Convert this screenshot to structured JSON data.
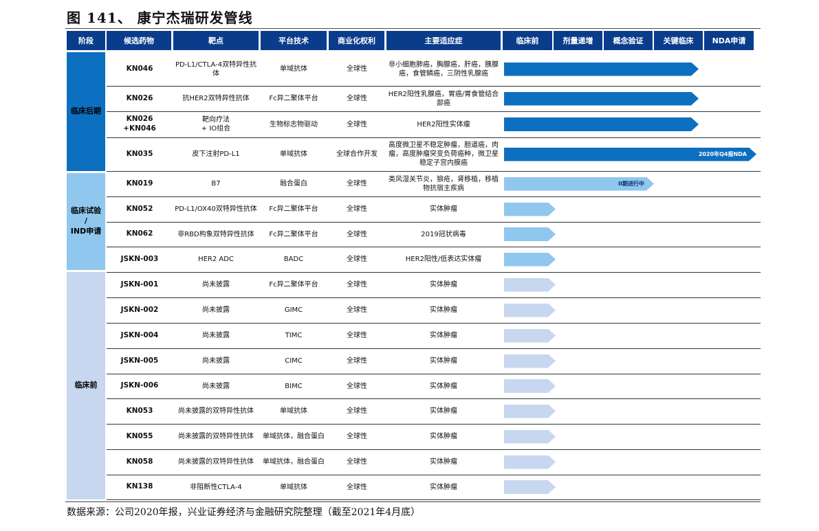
{
  "figure_title": "图 141、 康宁杰瑞研发管线",
  "source_note": "数据来源：公司2020年报，兴业证券经济与金融研究院整理（截至2021年4月底）",
  "colors": {
    "header_bg": "#0a3c8c",
    "stage_late": "#0d6fbf",
    "stage_ind": "#8fc7ee",
    "stage_pre": "#c6d7ef",
    "arrow_late": "#0d6fbf",
    "arrow_ind": "#8fc7ee",
    "arrow_pre": "#c6d7ef"
  },
  "headers": {
    "stage": "阶段",
    "drug": "候选药物",
    "target": "靶点",
    "platform": "平台技术",
    "commercial": "商业化权利",
    "indication": "主要适应症",
    "phases": [
      "临床前",
      "剂量递增",
      "概念验证",
      "关键临床",
      "NDA申请"
    ]
  },
  "stages": [
    {
      "label": "临床后期"
    },
    {
      "label": "临床试验\n/\nIND申请"
    },
    {
      "label": "临床前"
    }
  ],
  "rows": [
    {
      "drug": "KN046",
      "target": "PD-L1/CTLA-4双特异性抗体",
      "platform": "单域抗体",
      "commercial": "全球性",
      "indication": "非小细胞肺癌，胸腺癌，肝癌，胰腺癌，食管鳞癌，三阴性乳腺癌",
      "progress": "关键临床",
      "arrow_label": ""
    },
    {
      "drug": "KN026",
      "target": "抗HER2双特异性抗体",
      "platform": "Fc异二聚体平台",
      "commercial": "全球性",
      "indication": "HER2阳性乳腺癌，胃癌/胃食管结合部癌",
      "progress": "关键临床",
      "arrow_label": ""
    },
    {
      "drug": "KN026\n+KN046",
      "target": "靶向疗法\n+ IO组合",
      "platform": "生物标志物驱动",
      "commercial": "全球性",
      "indication": "HER2阳性实体瘤",
      "progress": "关键临床",
      "arrow_label": ""
    },
    {
      "drug": "KN035",
      "target": "皮下注射PD-L1",
      "platform": "单域抗体",
      "commercial": "全球合作开发",
      "indication": "高度微卫星不稳定肿瘤，胆道癌，肉瘤，高度肿瘤突变负荷癌种，微卫星稳定子宫内膜癌",
      "progress": "NDA申请",
      "arrow_label": "2020年Q4报NDA"
    },
    {
      "drug": "KN019",
      "target": "B7",
      "platform": "融合蛋白",
      "commercial": "全球性",
      "indication": "类风湿关节炎，狼疮，肾移植，移植物抗宿主疾病",
      "progress": "概念验证",
      "arrow_label": "II期进行中"
    },
    {
      "drug": "KN052",
      "target": "PD-L1/OX40双特异性抗体",
      "platform": "Fc异二聚体平台",
      "commercial": "全球性",
      "indication": "实体肿瘤",
      "progress": "临床前",
      "arrow_label": ""
    },
    {
      "drug": "KN062",
      "target": "非RBD构象双特异性抗体",
      "platform": "Fc异二聚体平台",
      "commercial": "全球性",
      "indication": "2019冠状病毒",
      "progress": "临床前",
      "arrow_label": ""
    },
    {
      "drug": "JSKN-003",
      "target": "HER2 ADC",
      "platform": "BADC",
      "commercial": "全球性",
      "indication": "HER2阳性/低表达实体瘤",
      "progress": "临床前",
      "arrow_label": ""
    },
    {
      "drug": "JSKN-001",
      "target": "尚未披露",
      "platform": "Fc异二聚体平台",
      "commercial": "全球性",
      "indication": "实体肿瘤",
      "progress": "临床前",
      "arrow_label": ""
    },
    {
      "drug": "JSKN-002",
      "target": "尚未披露",
      "platform": "GIMC",
      "commercial": "全球性",
      "indication": "实体肿瘤",
      "progress": "临床前",
      "arrow_label": ""
    },
    {
      "drug": "JSKN-004",
      "target": "尚未披露",
      "platform": "TIMC",
      "commercial": "全球性",
      "indication": "实体肿瘤",
      "progress": "临床前",
      "arrow_label": ""
    },
    {
      "drug": "JSKN-005",
      "target": "尚未披露",
      "platform": "CIMC",
      "commercial": "全球性",
      "indication": "实体肿瘤",
      "progress": "临床前",
      "arrow_label": ""
    },
    {
      "drug": "JSKN-006",
      "target": "尚未披露",
      "platform": "BIMC",
      "commercial": "全球性",
      "indication": "实体肿瘤",
      "progress": "临床前",
      "arrow_label": ""
    },
    {
      "drug": "KN053",
      "target": "尚未披露的双特异性抗体",
      "platform": "单域抗体",
      "commercial": "全球性",
      "indication": "实体肿瘤",
      "progress": "临床前",
      "arrow_label": ""
    },
    {
      "drug": "KN055",
      "target": "尚未披露的双特异性抗体",
      "platform": "单域抗体，融合蛋白",
      "commercial": "全球性",
      "indication": "实体肿瘤",
      "progress": "临床前",
      "arrow_label": ""
    },
    {
      "drug": "KN058",
      "target": "尚未披露的双特异性抗体",
      "platform": "单域抗体，融合蛋白",
      "commercial": "全球性",
      "indication": "实体肿瘤",
      "progress": "临床前",
      "arrow_label": ""
    },
    {
      "drug": "KN138",
      "target": "非阻断性CTLA-4",
      "platform": "单域抗体",
      "commercial": "全球性",
      "indication": "实体肿瘤",
      "progress": "临床前",
      "arrow_label": ""
    }
  ]
}
